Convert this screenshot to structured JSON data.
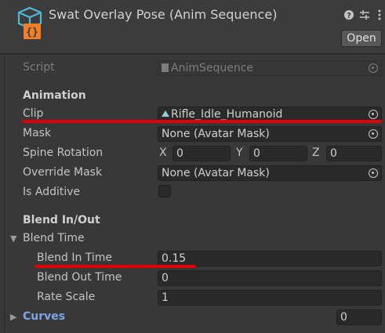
{
  "header": {
    "title": "Swat Overlay Pose (Anim Sequence)",
    "open_label": "Open",
    "icons": [
      "script-asset-icon",
      "help-icon",
      "settings-sliders-icon",
      "more-menu-icon"
    ]
  },
  "script_row": {
    "label": "Script",
    "value": "AnimSequence"
  },
  "animation": {
    "header": "Animation",
    "clip": {
      "label": "Clip",
      "value": "Rifle_Idle_Humanoid"
    },
    "mask": {
      "label": "Mask",
      "value": "None (Avatar Mask)"
    },
    "spine_rotation": {
      "label": "Spine Rotation",
      "x_label": "X",
      "x": "0",
      "y_label": "Y",
      "y": "0",
      "z_label": "Z",
      "z": "0"
    },
    "override_mask": {
      "label": "Override Mask",
      "value": "None (Avatar Mask)"
    },
    "is_additive": {
      "label": "Is Additive",
      "checked": false
    }
  },
  "blend": {
    "header": "Blend In/Out",
    "blend_time": {
      "label": "Blend Time",
      "blend_in": {
        "label": "Blend In Time",
        "value": "0.15"
      },
      "blend_out": {
        "label": "Blend Out Time",
        "value": "0"
      },
      "rate_scale": {
        "label": "Rate Scale",
        "value": "1"
      }
    }
  },
  "curves": {
    "label": "Curves",
    "count": "0"
  },
  "colors": {
    "annotation_red": "#e00000",
    "link_blue": "#7ea5e8"
  }
}
